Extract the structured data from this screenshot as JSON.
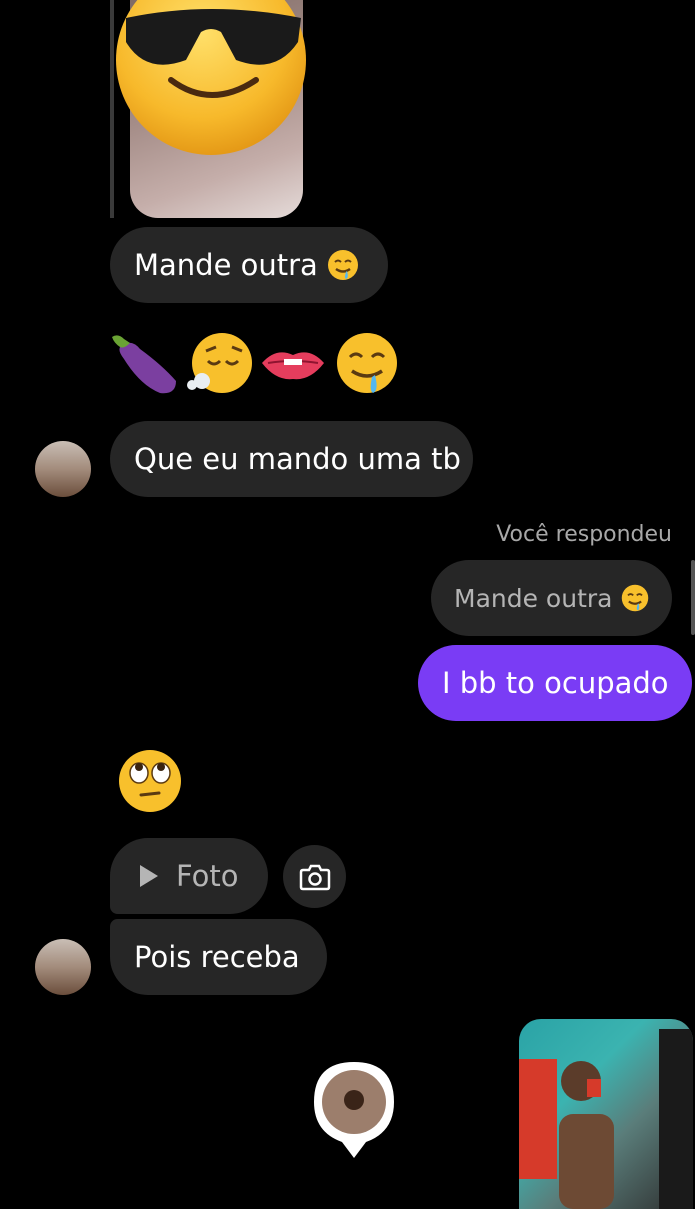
{
  "thread": {
    "messages": [
      {
        "id": "m1",
        "text": "Mande outra"
      },
      {
        "id": "m2",
        "text": "Que eu mando uma tb"
      },
      {
        "id": "m3",
        "label": "Você respondeu",
        "reply_text": "Mande outra",
        "text": "I bb to ocupado"
      },
      {
        "id": "m4",
        "foto_label": "Foto"
      },
      {
        "id": "m5",
        "text": "Pois receba"
      }
    ]
  },
  "icons": {
    "reaction_emojis": [
      "eggplant-icon",
      "face-exhaling-icon",
      "biting-lip-icon",
      "drooling-face-icon"
    ],
    "big_emoji": "rolling-eyes-icon",
    "play": "play-icon",
    "camera": "camera-icon",
    "location": "location-pin-icon"
  },
  "colors": {
    "background": "#000000",
    "bubble_received": "#262626",
    "bubble_sent": "#7a3cf5",
    "muted_text": "#a8a8a8"
  }
}
